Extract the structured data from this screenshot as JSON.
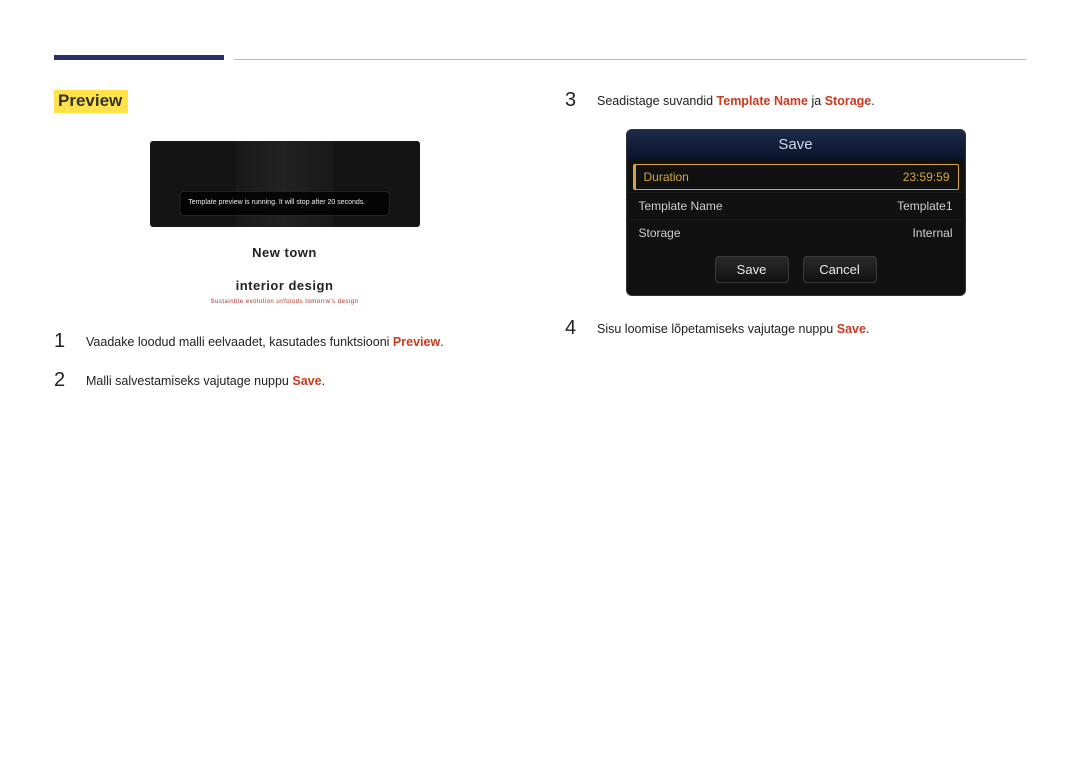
{
  "section_title": "Preview",
  "preview": {
    "running_msg": "Template preview is running. It will stop after 20 seconds.",
    "title_line1": "New town",
    "title_line2": "interior design",
    "tagline": "Sustainble evolution unfolods tomorrw's design"
  },
  "left_steps": [
    {
      "num": "1",
      "pre": "Vaadake loodud malli eelvaadet, kasutades funktsiooni ",
      "kw": "Preview",
      "post": "."
    },
    {
      "num": "2",
      "pre": "Malli salvestamiseks vajutage nuppu ",
      "kw": "Save",
      "post": "."
    }
  ],
  "right_steps": {
    "s3": {
      "num": "3",
      "pre": "Seadistage suvandid ",
      "kw1": "Template Name",
      "mid": " ja ",
      "kw2": "Storage",
      "post": "."
    },
    "s4": {
      "num": "4",
      "pre": "Sisu loomise lõpetamiseks vajutage nuppu ",
      "kw": "Save",
      "post": "."
    }
  },
  "dialog": {
    "title": "Save",
    "rows": [
      {
        "label": "Duration",
        "value": "23:59:59",
        "selected": true
      },
      {
        "label": "Template Name",
        "value": "Template1",
        "selected": false
      },
      {
        "label": "Storage",
        "value": "Internal",
        "selected": false
      }
    ],
    "save_label": "Save",
    "cancel_label": "Cancel"
  }
}
